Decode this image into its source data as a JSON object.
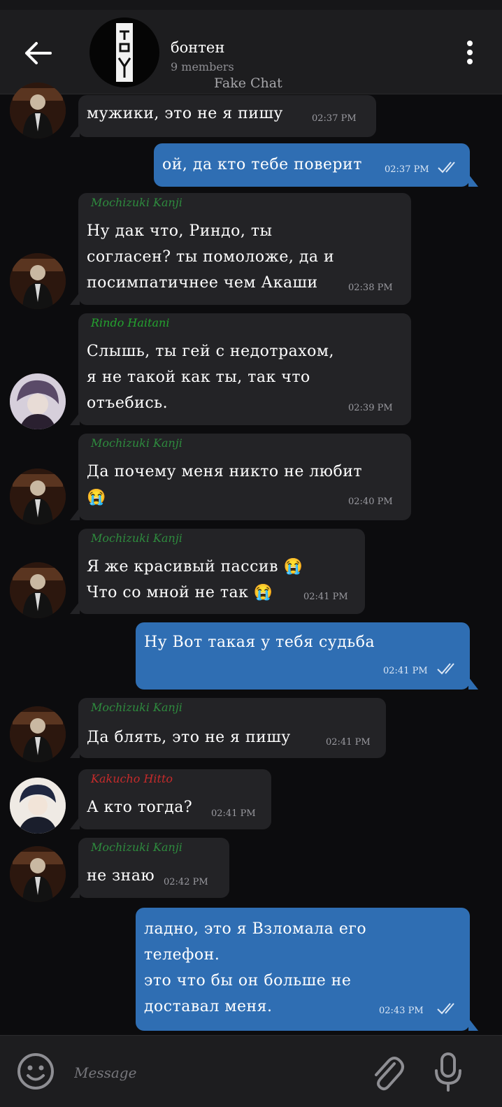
{
  "header": {
    "title": "бонтен",
    "subtitle": "9 members",
    "watermark": "Fake Chat"
  },
  "messages": [
    {
      "dir": "in",
      "sender": "",
      "lines": [
        "мужики, это не я пишу"
      ],
      "time": "02:37 PM"
    },
    {
      "dir": "out",
      "lines": [
        "ой, да кто тебе поверит"
      ],
      "time": "02:37 PM"
    },
    {
      "dir": "in",
      "sender": "Mochizuki Kanji",
      "lines": [
        "Ну дак что, Риндо, ты",
        "согласен? ты помоложе, да и",
        "посимпатичнее чем Акаши"
      ],
      "time": "02:38 PM"
    },
    {
      "dir": "in",
      "sender": "Rindo Haitani",
      "lines": [
        "Слышь, ты гей с недотрахом,",
        "я не такой как ты, так что",
        "отъебись."
      ],
      "time": "02:39 PM"
    },
    {
      "dir": "in",
      "sender": "Mochizuki Kanji",
      "lines": [
        "Да почему меня никто не любит",
        "😭"
      ],
      "time": "02:40 PM"
    },
    {
      "dir": "in",
      "sender": "Mochizuki Kanji",
      "lines": [
        "Я же красивый пассив 😭",
        "Что со мной не так 😭"
      ],
      "time": "02:41 PM"
    },
    {
      "dir": "out",
      "lines": [
        "Ну Вот такая у тебя судьба"
      ],
      "time": "02:41 PM"
    },
    {
      "dir": "in",
      "sender": "Mochizuki Kanji",
      "lines": [
        "Да блять, это не я пишу"
      ],
      "time": "02:41 PM"
    },
    {
      "dir": "in",
      "sender": "Kakucho Hitto",
      "lines": [
        "А кто тогда?"
      ],
      "time": "02:41 PM"
    },
    {
      "dir": "in",
      "sender": "Mochizuki Kanji",
      "lines": [
        "не знаю"
      ],
      "time": "02:42 PM"
    },
    {
      "dir": "out",
      "lines": [
        "ладно, это я Взломала его",
        "телефон.",
        "это что бы он больше не",
        "доставал меня."
      ],
      "time": "02:43 PM"
    }
  ],
  "composer": {
    "placeholder": "Message"
  },
  "colors": {
    "background": "#0c0c0e",
    "incoming_bubble": "#232326",
    "outgoing_bubble": "#2f6eb3",
    "name_kanji": "#2e8b3e",
    "name_rindo": "#24a32f",
    "name_kakucho": "#c62b2b"
  }
}
